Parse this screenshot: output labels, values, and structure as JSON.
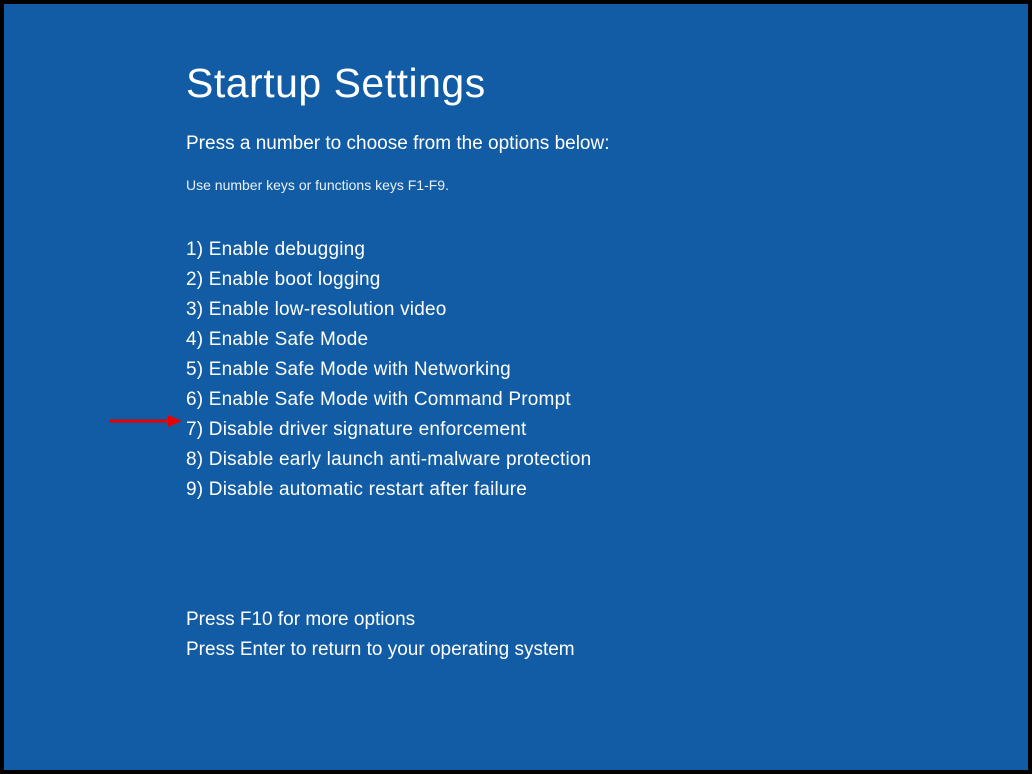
{
  "title": "Startup Settings",
  "subtitle": "Press a number to choose from the options below:",
  "hint": "Use number keys or functions keys F1-F9.",
  "options": [
    "1) Enable debugging",
    "2) Enable boot logging",
    "3) Enable low-resolution video",
    "4) Enable Safe Mode",
    "5) Enable Safe Mode with Networking",
    "6) Enable Safe Mode with Command Prompt",
    "7) Disable driver signature enforcement",
    "8) Disable early launch anti-malware protection",
    "9) Disable automatic restart after failure"
  ],
  "footer": {
    "more": "Press F10 for more options",
    "return": "Press Enter to return to your operating system"
  },
  "annotation": {
    "arrow_points_to_option_index": 6,
    "arrow_color": "#e60000"
  }
}
